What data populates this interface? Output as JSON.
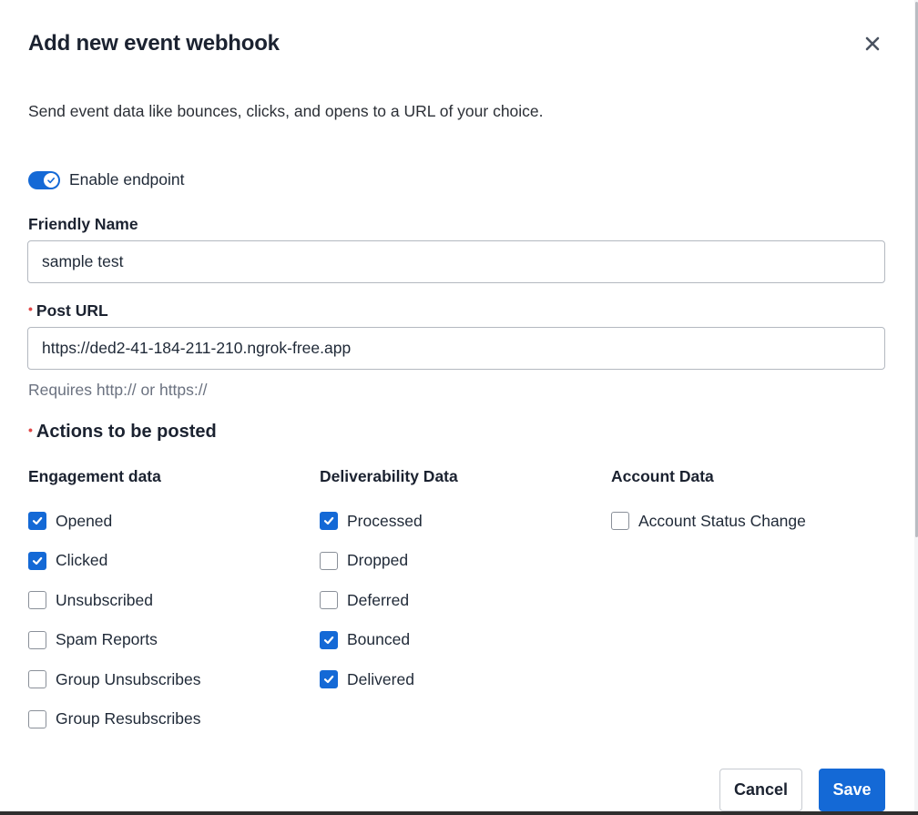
{
  "modal": {
    "title": "Add new event webhook",
    "description": "Send event data like bounces, clicks, and opens to a URL of your choice."
  },
  "enable_endpoint": {
    "label": "Enable endpoint",
    "enabled": true
  },
  "friendly_name": {
    "label": "Friendly Name",
    "value": "sample test"
  },
  "post_url": {
    "required_marker": "•",
    "label": "Post URL",
    "value": "https://ded2-41-184-211-210.ngrok-free.app",
    "hint": "Requires http:// or https://"
  },
  "actions": {
    "required_marker": "•",
    "title": "Actions to be posted",
    "engagement": {
      "heading": "Engagement data",
      "items": [
        {
          "label": "Opened",
          "checked": true
        },
        {
          "label": "Clicked",
          "checked": true
        },
        {
          "label": "Unsubscribed",
          "checked": false
        },
        {
          "label": "Spam Reports",
          "checked": false
        },
        {
          "label": "Group Unsubscribes",
          "checked": false
        },
        {
          "label": "Group Resubscribes",
          "checked": false
        }
      ]
    },
    "deliverability": {
      "heading": "Deliverability Data",
      "items": [
        {
          "label": "Processed",
          "checked": true
        },
        {
          "label": "Dropped",
          "checked": false
        },
        {
          "label": "Deferred",
          "checked": false
        },
        {
          "label": "Bounced",
          "checked": true
        },
        {
          "label": "Delivered",
          "checked": true
        }
      ]
    },
    "account": {
      "heading": "Account Data",
      "items": [
        {
          "label": "Account Status Change",
          "checked": false
        }
      ]
    }
  },
  "buttons": {
    "cancel": "Cancel",
    "save": "Save"
  },
  "colors": {
    "accent": "#1469d6",
    "required": "#e04848",
    "hint": "#6b7280"
  },
  "icons": {
    "close": "close-icon",
    "toggle_check": "check-icon",
    "checkbox_check": "check-icon"
  }
}
